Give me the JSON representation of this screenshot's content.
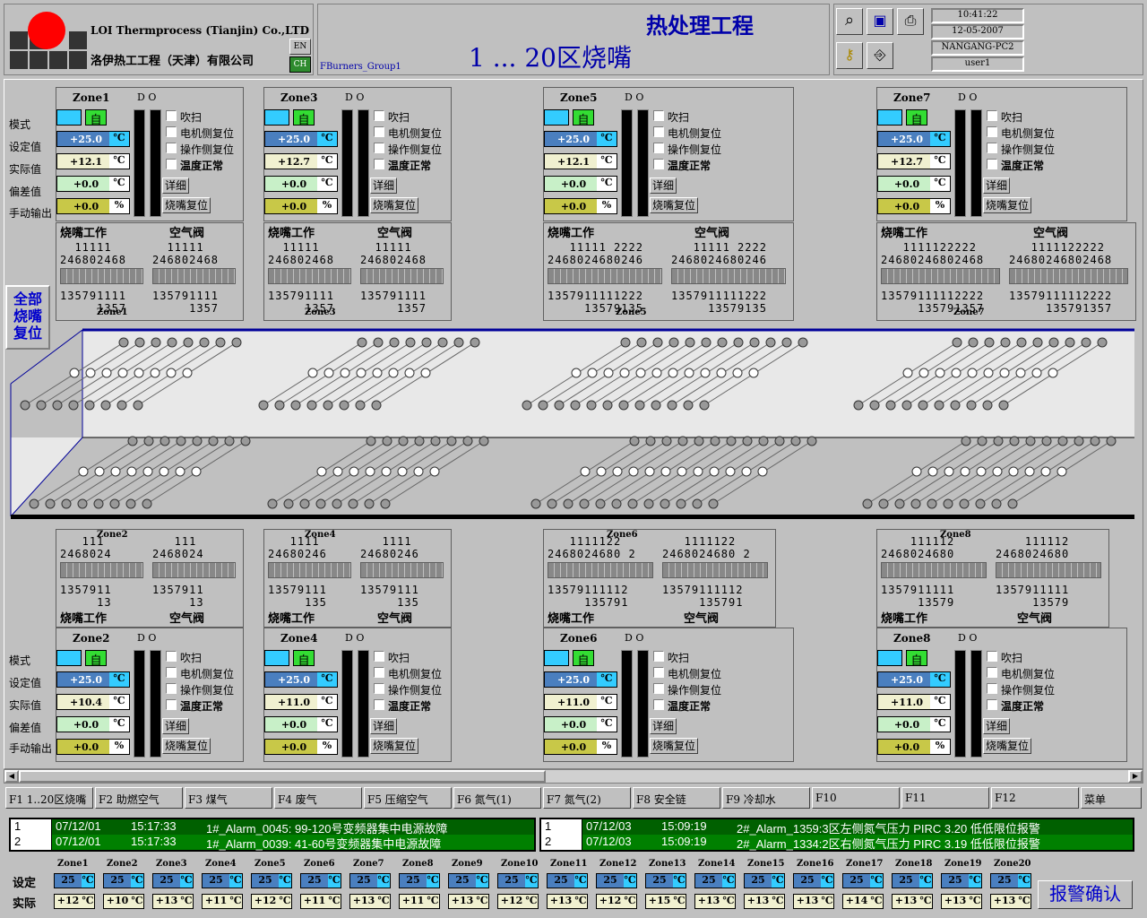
{
  "header": {
    "company_en": "LOI Thermprocess (Tianjin) Co.,LTD",
    "company_cn": "洛伊热工工程（天津）有限公司",
    "lang_en": "EN",
    "lang_cn": "CH",
    "title1": "热处理工程",
    "title2": "1 ... 20区烧嘴",
    "group": "FBurners_Group1",
    "time": "10:41:22",
    "date": "12-05-2007",
    "host": "NANGANG-PC2",
    "user": "user1"
  },
  "labels": {
    "mode": "模式",
    "setpoint": "设定值",
    "actual": "实际值",
    "deviation": "偏差值",
    "manual": "手动输出",
    "purge": "吹扫",
    "motor_reset": "电机侧复位",
    "op_reset": "操作侧复位",
    "temp_ok": "温度正常",
    "detail": "详细",
    "burner_reset": "烧嘴复位",
    "auto": "自",
    "dd": "D O",
    "burner_work": "烧嘴工作",
    "air_valve": "空气阀",
    "all_reset": "全部烧嘴复位",
    "deg": "℃",
    "pct": "%"
  },
  "zones": [
    {
      "name": "Zone1",
      "sp": "+25.0",
      "pv": "+12.1",
      "dv": "+0.0",
      "out": "+0.0",
      "tens": "  11111",
      "evens": "246802468",
      "odds": "135791111",
      "odds2": "     1357",
      "foot": "Zone1"
    },
    {
      "name": "Zone3",
      "sp": "+25.0",
      "pv": "+12.7",
      "dv": "+0.0",
      "out": "+0.0",
      "tens": "  11111",
      "evens": "246802468",
      "odds": "135791111",
      "odds2": "     1357",
      "foot": "Zone3"
    },
    {
      "name": "Zone5",
      "sp": "+25.0",
      "pv": "+12.1",
      "dv": "+0.0",
      "out": "+0.0",
      "tens": "   11111 2222",
      "evens": "2468024680246",
      "odds": "1357911111222",
      "odds2": "     13579135",
      "foot": "Zone5"
    },
    {
      "name": "Zone7",
      "sp": "+25.0",
      "pv": "+12.7",
      "dv": "+0.0",
      "out": "+0.0",
      "tens": "   1111122222",
      "evens": "24680246802468",
      "odds": "13579111112222",
      "odds2": "     135791357",
      "foot": "Zone7"
    },
    {
      "name": "Zone2",
      "sp": "+25.0",
      "pv": "+10.4",
      "dv": "+0.0",
      "out": "+0.0",
      "tens": "   111",
      "evens": "2468024",
      "odds": "1357911",
      "odds2": "     13",
      "foot": "Zone2"
    },
    {
      "name": "Zone4",
      "sp": "+25.0",
      "pv": "+11.0",
      "dv": "+0.0",
      "out": "+0.0",
      "tens": "   1111",
      "evens": "24680246",
      "odds": "13579111",
      "odds2": "     135",
      "foot": "Zone4"
    },
    {
      "name": "Zone6",
      "sp": "+25.0",
      "pv": "+11.0",
      "dv": "+0.0",
      "out": "+0.0",
      "tens": "   1111122",
      "evens": "2468024680 2",
      "odds": "13579111112",
      "odds2": "     135791",
      "foot": "Zone6"
    },
    {
      "name": "Zone8",
      "sp": "+25.0",
      "pv": "+11.0",
      "dv": "+0.0",
      "out": "+0.0",
      "tens": "    111112",
      "evens": "2468024680",
      "odds": "1357911111",
      "odds2": "     13579",
      "foot": "Zone8"
    }
  ],
  "fkeys": [
    "F1 1..20区烧嘴",
    "F2 助燃空气",
    "F3 煤气",
    "F4 废气",
    "F5 压缩空气",
    "F6 氮气(1)",
    "F7 氮气(2)",
    "F8 安全链",
    "F9 冷却水",
    "F10",
    "F11",
    "F12",
    "菜单"
  ],
  "alarms_left": [
    {
      "n": "1",
      "date": "07/12/01",
      "time": "15:17:33",
      "msg": "1#_Alarm_0045: 99-120号变频器集中电源故障"
    },
    {
      "n": "2",
      "date": "07/12/01",
      "time": "15:17:33",
      "msg": "1#_Alarm_0039: 41-60号变频器集中电源故障"
    }
  ],
  "alarms_right": [
    {
      "n": "1",
      "date": "07/12/03",
      "time": "15:09:19",
      "msg": "2#_Alarm_1359:3区左侧氮气压力 PIRC 3.20 低低限位报警"
    },
    {
      "n": "2",
      "date": "07/12/03",
      "time": "15:09:19",
      "msg": "2#_Alarm_1334:2区右侧氮气压力 PIRC 3.19 低低限位报警"
    }
  ],
  "summary": {
    "set_label": "设定",
    "act_label": "实际",
    "ack": "报警确认",
    "zones": [
      "Zone1",
      "Zone2",
      "Zone3",
      "Zone4",
      "Zone5",
      "Zone6",
      "Zone7",
      "Zone8",
      "Zone9",
      "Zone10",
      "Zone11",
      "Zone12",
      "Zone13",
      "Zone14",
      "Zone15",
      "Zone16",
      "Zone17",
      "Zone18",
      "Zone19",
      "Zone20"
    ],
    "set": [
      "25",
      "25",
      "25",
      "25",
      "25",
      "25",
      "25",
      "25",
      "25",
      "25",
      "25",
      "25",
      "25",
      "25",
      "25",
      "25",
      "25",
      "25",
      "25",
      "25"
    ],
    "act": [
      "+12",
      "+10",
      "+13",
      "+11",
      "+12",
      "+11",
      "+13",
      "+11",
      "+13",
      "+12",
      "+13",
      "+12",
      "+15",
      "+13",
      "+13",
      "+13",
      "+14",
      "+13",
      "+13",
      "+13"
    ]
  },
  "colors": {
    "blue_val": "#4a7fbf",
    "actual_val": "#f0f0d0",
    "dev_val": "#c8f0c8",
    "out_val": "#c8c848",
    "furnace": "#e8e8e8",
    "accent": "#0000cc"
  }
}
